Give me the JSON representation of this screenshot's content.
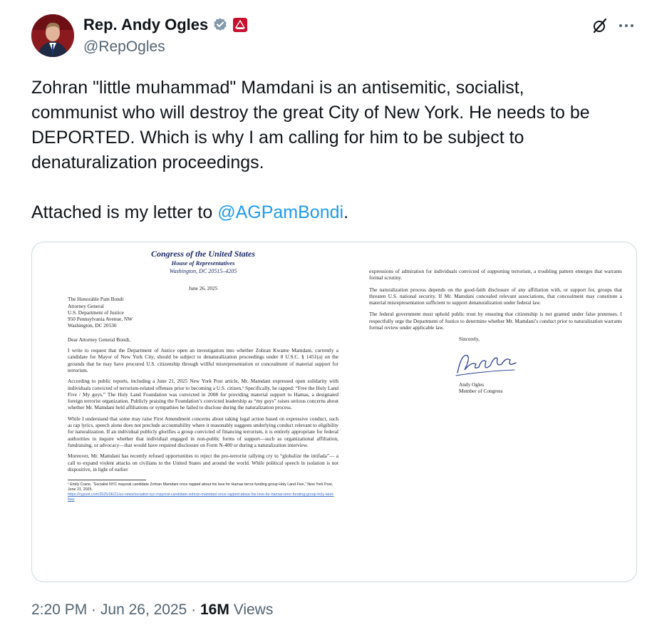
{
  "author": {
    "display_name": "Rep. Andy Ogles",
    "handle": "@RepOgles",
    "verified_icon": "verified-gray-check-icon",
    "affiliation_badge": "us-flag-badge-icon",
    "brand_color": "#7a1218"
  },
  "actions": {
    "grok_icon": "grok-slash-icon",
    "more_icon": "ellipsis-icon"
  },
  "tweet": {
    "lines": [
      "Zohran \"little muhammad\" Mamdani is an antisemitic, socialist,",
      "communist who will destroy the great City of New York. He needs to be",
      "DEPORTED. Which is why I am calling for him to be subject to",
      "denaturalization proceedings."
    ],
    "attached_prefix": "Attached is my letter to ",
    "mention": "@AGPamBondi",
    "attached_suffix": ".",
    "mention_color": "#1d9bf0"
  },
  "letter": {
    "letterhead_line1": "Congress of the United States",
    "letterhead_line2": "House of Representatives",
    "letterhead_line3": "Washington, DC 20515–4205",
    "date": "June 26, 2025",
    "address_lines": [
      "The Honorable Pam Bondi",
      "Attorney General",
      "U.S. Department of Justice",
      "950 Pennsylvania Avenue, NW",
      "Washington, DC 20530"
    ],
    "salutation": "Dear Attorney General Bondi,",
    "para1": "I write to request that the Department of Justice open an investigation into whether Zohran Kwame Mamdani, currently a candidate for Mayor of New York City, should be subject to denaturalization proceedings under 8 U.S.C. § 1451(a) on the grounds that he may have procured U.S. citizenship through willful misrepresentation or concealment of material support for terrorism.",
    "para2": "According to public reports, including a June 21, 2025 New York Post article, Mr. Mamdani expressed open solidarity with individuals convicted of terrorism-related offenses prior to becoming a U.S. citizen.¹ Specifically, he rapped: “Free the Holy Land Five / My guys.” The Holy Land Foundation was convicted in 2008 for providing material support to Hamas, a designated foreign terrorist organization. Publicly praising the Foundation’s convicted leadership as “my guys” raises serious concerns about whether Mr. Mamdani held affiliations or sympathies he failed to disclose during the naturalization process.",
    "para3": "While I understand that some may raise First Amendment concerns about taking legal action based on expressive conduct, such as rap lyrics, speech alone does not preclude accountability where it reasonably suggests underlying conduct relevant to eligibility for naturalization. If an individual publicly glorifies a group convicted of financing terrorism, it is entirely appropriate for federal authorities to inquire whether that individual engaged in non-public forms of support—such as organizational affiliation, fundraising, or advocacy—that would have required disclosure on Form N-400 or during a naturalization interview.",
    "para4": "Moreover, Mr. Mamdani has recently refused opportunities to reject the pro-terrorist rallying cry to “globalize the intifada”— a call to expand violent attacks on civilians to the United States and around the world. While political speech in isolation is not dispositive, in light of earlier",
    "footnote": "¹ Emily Crane, “Socialist NYC mayoral candidate Zohran Mamdani once rapped about his love for Hamas terror-funding group Holy Land Five,” New York Post, June 21, 2025.",
    "footnote_link": "https://nypost.com/2025/06/21/us-news/socialist-nyc-mayoral-candidate-zohran-mamdani-once-rapped-about-his-love-for-hamas-teror-funding-group-holy-land-five/",
    "page2_para1": "expressions of admiration for individuals convicted of supporting terrorism, a troubling pattern emerges that warrants formal scrutiny.",
    "page2_para2": "The naturalization process depends on the good-faith disclosure of any affiliation with, or support for, groups that threaten U.S. national security. If Mr. Mamdani concealed relevant associations, that concealment may constitute a material misrepresentation sufficient to support denaturalization under federal law.",
    "page2_para3": "The federal government must uphold public trust by ensuring that citizenship is not granted under false pretenses. I respectfully urge the Department of Justice to determine whether Mr. Mamdani’s conduct prior to naturalization warrants formal review under applicable law.",
    "closing": "Sincerely,",
    "signature_icon": "handwritten-signature-andy-ogles",
    "signer_name": "Andy Ogles",
    "signer_title": "Member of Congress"
  },
  "footer": {
    "time": "2:20 PM",
    "separator": " · ",
    "date": "Jun 26, 2025",
    "views_count": "16M",
    "views_label": " Views"
  }
}
